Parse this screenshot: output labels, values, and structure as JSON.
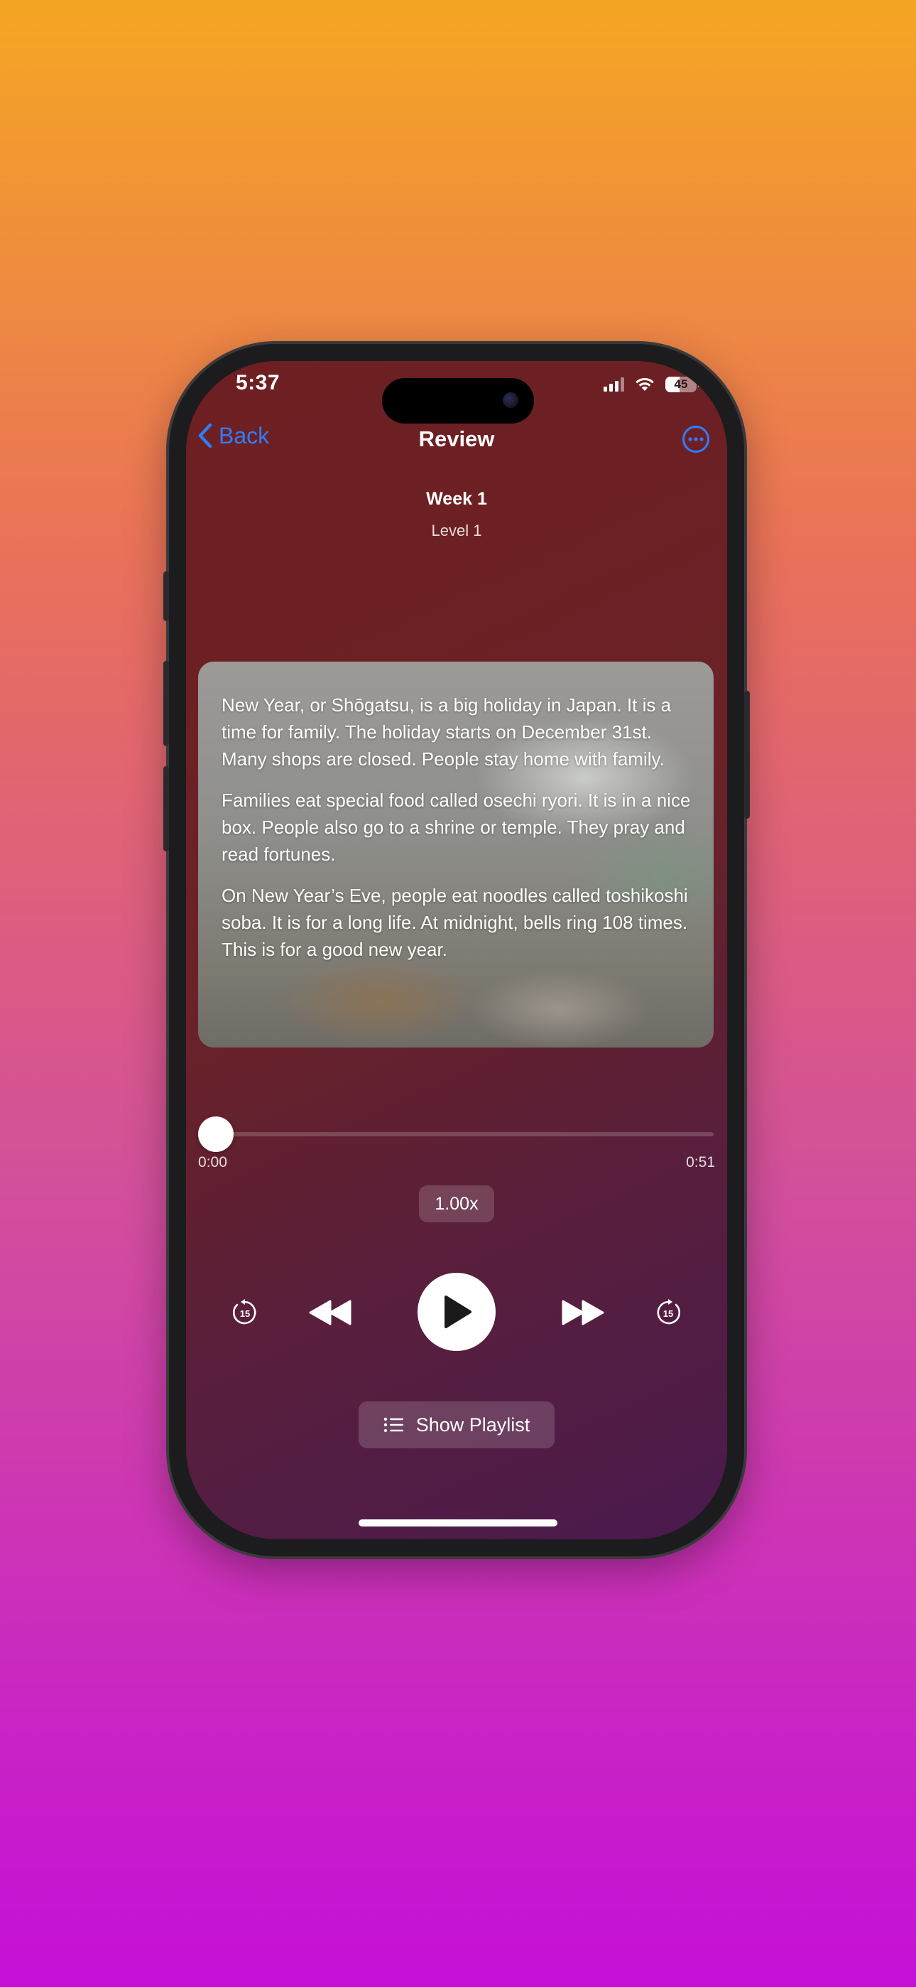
{
  "status_bar": {
    "time": "5:37",
    "battery": "45",
    "battery_level": 0.45
  },
  "nav": {
    "back_label": "Back",
    "title": "Review"
  },
  "lesson": {
    "week": "Week 1",
    "level": "Level 1"
  },
  "reading": {
    "paragraphs": [
      "New Year, or Shōgatsu, is a big holiday in Japan. It is a time for family. The holiday starts on December 31st. Many shops are closed. People stay home with family.",
      "Families eat special food called osechi ryori. It is in a nice box. People also go to a shrine or temple. They pray and read fortunes.",
      "On New Year’s Eve, people eat noodles called toshikoshi soba. It is for a long life. At midnight, bells ring 108 times. This is for a good new year."
    ]
  },
  "player": {
    "elapsed": "0:00",
    "duration": "0:51",
    "progress": 0.0,
    "speed": "1.00x",
    "skip_seconds": "15",
    "playlist_label": "Show Playlist"
  },
  "colors": {
    "accent": "#2f7dff",
    "page_gradient_top": "#f5a623",
    "page_gradient_bottom": "#c50fd8",
    "screen_background": "#6a2226"
  },
  "icons": {
    "back": "chevron-left-icon",
    "more": "ellipsis-circle-icon",
    "skip_back": "gobackward-15-icon",
    "rewind": "backward-icon",
    "play": "play-icon",
    "fast_forward": "forward-icon",
    "skip_forward": "goforward-15-icon",
    "playlist": "list-bullet-icon"
  }
}
